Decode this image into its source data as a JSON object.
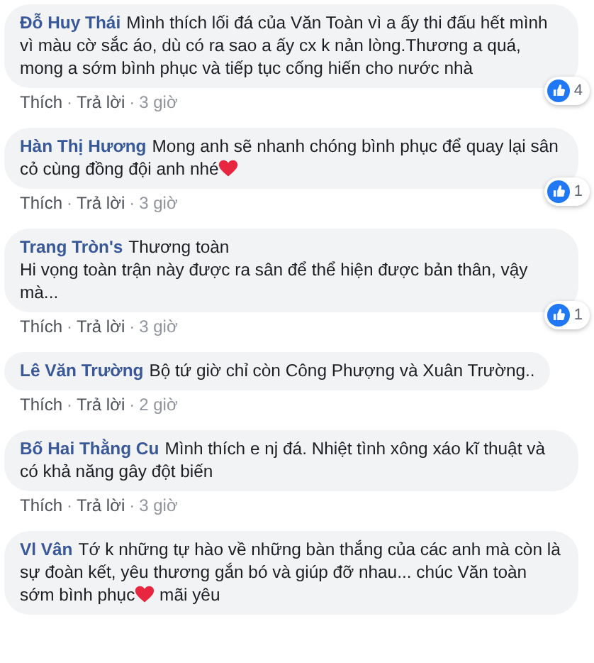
{
  "comments": [
    {
      "author": "Đỗ Huy Thái",
      "segments": [
        {
          "kind": "text",
          "text": "Mình thích lối đá của Văn Toàn vì a ấy thi đấu hết mình vì màu cờ sắc áo, dù có ra sao a ấy cx k nản lòng.Thương a quá, mong a sớm bình phục và tiếp tục cống hiến cho nước nhà"
        }
      ],
      "actions": {
        "like": "Thích",
        "sep1": "·",
        "reply": "Trả lời",
        "sep2": "·",
        "time": "3 giờ"
      },
      "reactions": "4"
    },
    {
      "author": "Hàn Thị Hương",
      "segments": [
        {
          "kind": "text",
          "text": "Mong anh sẽ nhanh chóng bình phục để quay lại sân cỏ cùng đồng đội anh nhé"
        },
        {
          "kind": "heart"
        }
      ],
      "actions": {
        "like": "Thích",
        "sep1": "·",
        "reply": "Trả lời",
        "sep2": "·",
        "time": "3 giờ"
      },
      "reactions": "1"
    },
    {
      "author": "Trang Tròn's",
      "segments": [
        {
          "kind": "text",
          "text": "Thương toàn"
        },
        {
          "kind": "break"
        },
        {
          "kind": "text",
          "text": "Hi vọng toàn trận này được ra sân để thể hiện được bản thân, vậy mà..."
        }
      ],
      "actions": {
        "like": "Thích",
        "sep1": "·",
        "reply": "Trả lời",
        "sep2": "·",
        "time": "3 giờ"
      },
      "reactions": "1"
    },
    {
      "author": "Lê Văn Trường",
      "segments": [
        {
          "kind": "text",
          "text": "Bộ tứ giờ chỉ còn Công Phượng và Xuân Trường.."
        }
      ],
      "actions": {
        "like": "Thích",
        "sep1": "·",
        "reply": "Trả lời",
        "sep2": "·",
        "time": "2 giờ"
      }
    },
    {
      "author": "Bố Hai Thằng Cu",
      "segments": [
        {
          "kind": "text",
          "text": "Mình thích e nj đá. Nhiệt tình xông xáo kĩ thuật và có khả năng gây đột biến"
        }
      ],
      "actions": {
        "like": "Thích",
        "sep1": "·",
        "reply": "Trả lời",
        "sep2": "·",
        "time": "3 giờ"
      }
    },
    {
      "author": "Vl Vân",
      "segments": [
        {
          "kind": "text",
          "text": "Tớ k những tự hào về những bàn thắng của các anh mà còn là sự đoàn kết, yêu thương gắn bó và giúp đỡ nhau... chúc Văn toàn sớm bình phục"
        },
        {
          "kind": "heart"
        },
        {
          "kind": "text",
          "text": " mãi yêu"
        }
      ]
    }
  ]
}
